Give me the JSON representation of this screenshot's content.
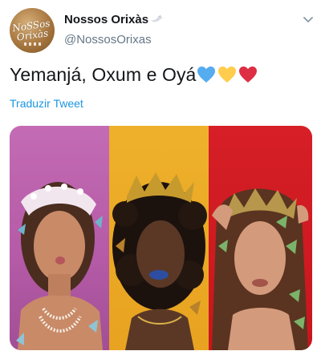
{
  "account": {
    "display_name": "Nossos Orixàs",
    "username": "@NossosOrixas",
    "avatar_text_line1": "NoSSos",
    "avatar_text_line2": "Orixàs"
  },
  "tweet": {
    "text": "Yemanjá, Oxum e Oyá",
    "hearts": [
      "blue-heart",
      "yellow-heart",
      "red-heart"
    ],
    "translate_label": "Traduzir Tweet"
  },
  "media": {
    "panels": [
      {
        "name": "yemanja-photo",
        "color": "#c46bb5"
      },
      {
        "name": "oxum-photo",
        "color": "#eeb02b"
      },
      {
        "name": "oya-photo",
        "color": "#d61f26"
      }
    ]
  },
  "colors": {
    "link": "#1b95e0",
    "secondary_text": "#657786",
    "heart_blue": "#55acee",
    "heart_yellow": "#ffcc4d",
    "heart_red": "#dd2e44"
  },
  "icons": {
    "header_menu": "chevron-down-icon",
    "name_badge": "dove-icon"
  }
}
